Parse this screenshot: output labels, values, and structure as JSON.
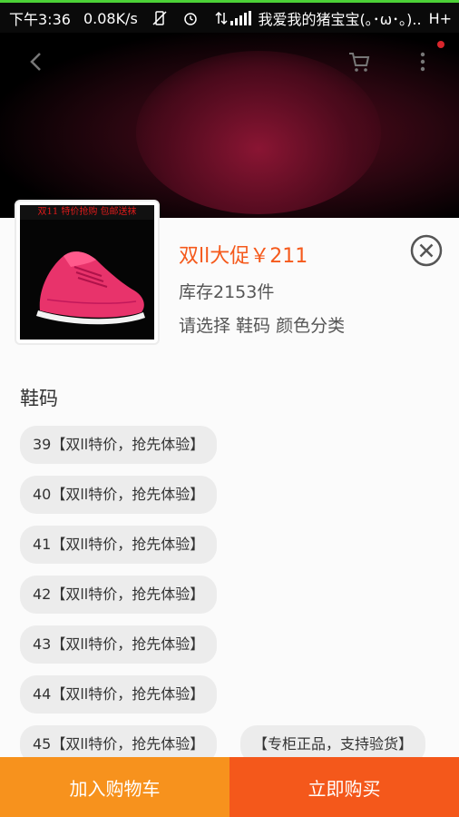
{
  "status_bar": {
    "time": "下午3:36",
    "net_speed": "0.08K/s",
    "carrier": "我爱我的猪宝宝(｡･ω･｡)..",
    "network_type": "H+",
    "icons": [
      "vibrate-off-icon",
      "alarm-icon",
      "data-arrows-icon",
      "signal-icon"
    ]
  },
  "header": {
    "icons": [
      "back-icon",
      "cart-icon",
      "more-icon"
    ]
  },
  "product": {
    "thumb_banner": "双11 特价抢购 包邮送袜",
    "price": "双ll大促￥211",
    "stock": "库存2153件",
    "choose_prompt": "请选择 鞋码 颜色分类"
  },
  "sizes": {
    "title": "鞋码",
    "options": [
      "39【双ll特价，抢先体验】",
      "40【双ll特价，抢先体验】",
      "41【双ll特价，抢先体验】",
      "42【双ll特价，抢先体验】",
      "43【双ll特价，抢先体验】",
      "44【双ll特价，抢先体验】",
      "45【双ll特价，抢先体验】",
      "【专柜正品，支持验货】"
    ]
  },
  "actions": {
    "add_to_cart": "加入购物车",
    "buy_now": "立即购买"
  },
  "colors": {
    "accent_price": "#f5591b",
    "cart_button": "#f7921d",
    "buy_button": "#f4581b",
    "chip_bg": "#ececec"
  }
}
